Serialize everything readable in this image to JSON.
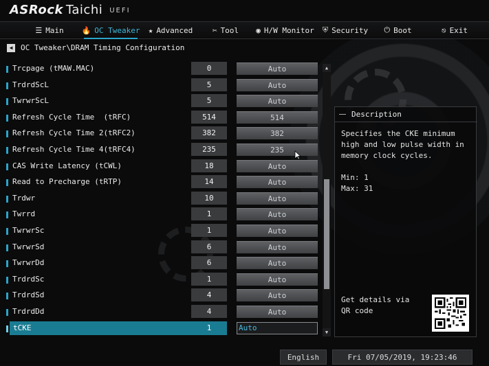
{
  "brand": {
    "name": "ASRock",
    "model": "Taichi",
    "firmware": "UEFI"
  },
  "nav": [
    {
      "id": "main",
      "label": "Main",
      "icon": "list-icon",
      "glyph": "☰",
      "active": false
    },
    {
      "id": "oc-tweaker",
      "label": "OC Tweaker",
      "icon": "flame-icon",
      "glyph": "🔥",
      "active": true
    },
    {
      "id": "advanced",
      "label": "Advanced",
      "icon": "star-icon",
      "glyph": "★",
      "active": false
    },
    {
      "id": "tool",
      "label": "Tool",
      "icon": "tools-icon",
      "glyph": "✂",
      "active": false
    },
    {
      "id": "hw-monitor",
      "label": "H/W Monitor",
      "icon": "monitor-icon",
      "glyph": "◉",
      "active": false
    },
    {
      "id": "security",
      "label": "Security",
      "icon": "shield-icon",
      "glyph": "⛨",
      "active": false
    },
    {
      "id": "boot",
      "label": "Boot",
      "icon": "power-icon",
      "glyph": "⏻",
      "active": false
    },
    {
      "id": "exit",
      "label": "Exit",
      "icon": "exit-door-icon",
      "glyph": "⎋",
      "active": false
    }
  ],
  "breadcrumb": {
    "back_glyph": "◀",
    "path": "OC Tweaker\\DRAM Timing Configuration"
  },
  "settings": [
    {
      "label": "Trcpage (tMAW.MAC)",
      "current": "0",
      "option": "Auto"
    },
    {
      "label": "TrdrdScL",
      "current": "5",
      "option": "Auto"
    },
    {
      "label": "TwrwrScL",
      "current": "5",
      "option": "Auto"
    },
    {
      "label": "Refresh Cycle Time  (tRFC)",
      "current": "514",
      "option": "514"
    },
    {
      "label": "Refresh Cycle Time 2(tRFC2)",
      "current": "382",
      "option": "382"
    },
    {
      "label": "Refresh Cycle Time 4(tRFC4)",
      "current": "235",
      "option": "235"
    },
    {
      "label": "CAS Write Latency (tCWL)",
      "current": "18",
      "option": "Auto"
    },
    {
      "label": "Read to Precharge (tRTP)",
      "current": "14",
      "option": "Auto"
    },
    {
      "label": "Trdwr",
      "current": "10",
      "option": "Auto"
    },
    {
      "label": "Twrrd",
      "current": "1",
      "option": "Auto"
    },
    {
      "label": "TwrwrSc",
      "current": "1",
      "option": "Auto"
    },
    {
      "label": "TwrwrSd",
      "current": "6",
      "option": "Auto"
    },
    {
      "label": "TwrwrDd",
      "current": "6",
      "option": "Auto"
    },
    {
      "label": "TrdrdSc",
      "current": "1",
      "option": "Auto"
    },
    {
      "label": "TrdrdSd",
      "current": "4",
      "option": "Auto"
    },
    {
      "label": "TrdrdDd",
      "current": "4",
      "option": "Auto"
    },
    {
      "label": "tCKE",
      "current": "1",
      "option": "Auto",
      "selected": true
    }
  ],
  "scrollbar": {
    "up_glyph": "▲",
    "down_glyph": "▼"
  },
  "description": {
    "title": "Description",
    "text": "Specifies the CKE minimum high and low pulse width in memory clock cycles.\n\nMin: 1\nMax: 31",
    "qr_label": "Get details via QR code"
  },
  "footer": {
    "language": "English",
    "datetime": "Fri 07/05/2019, 19:23:46"
  }
}
